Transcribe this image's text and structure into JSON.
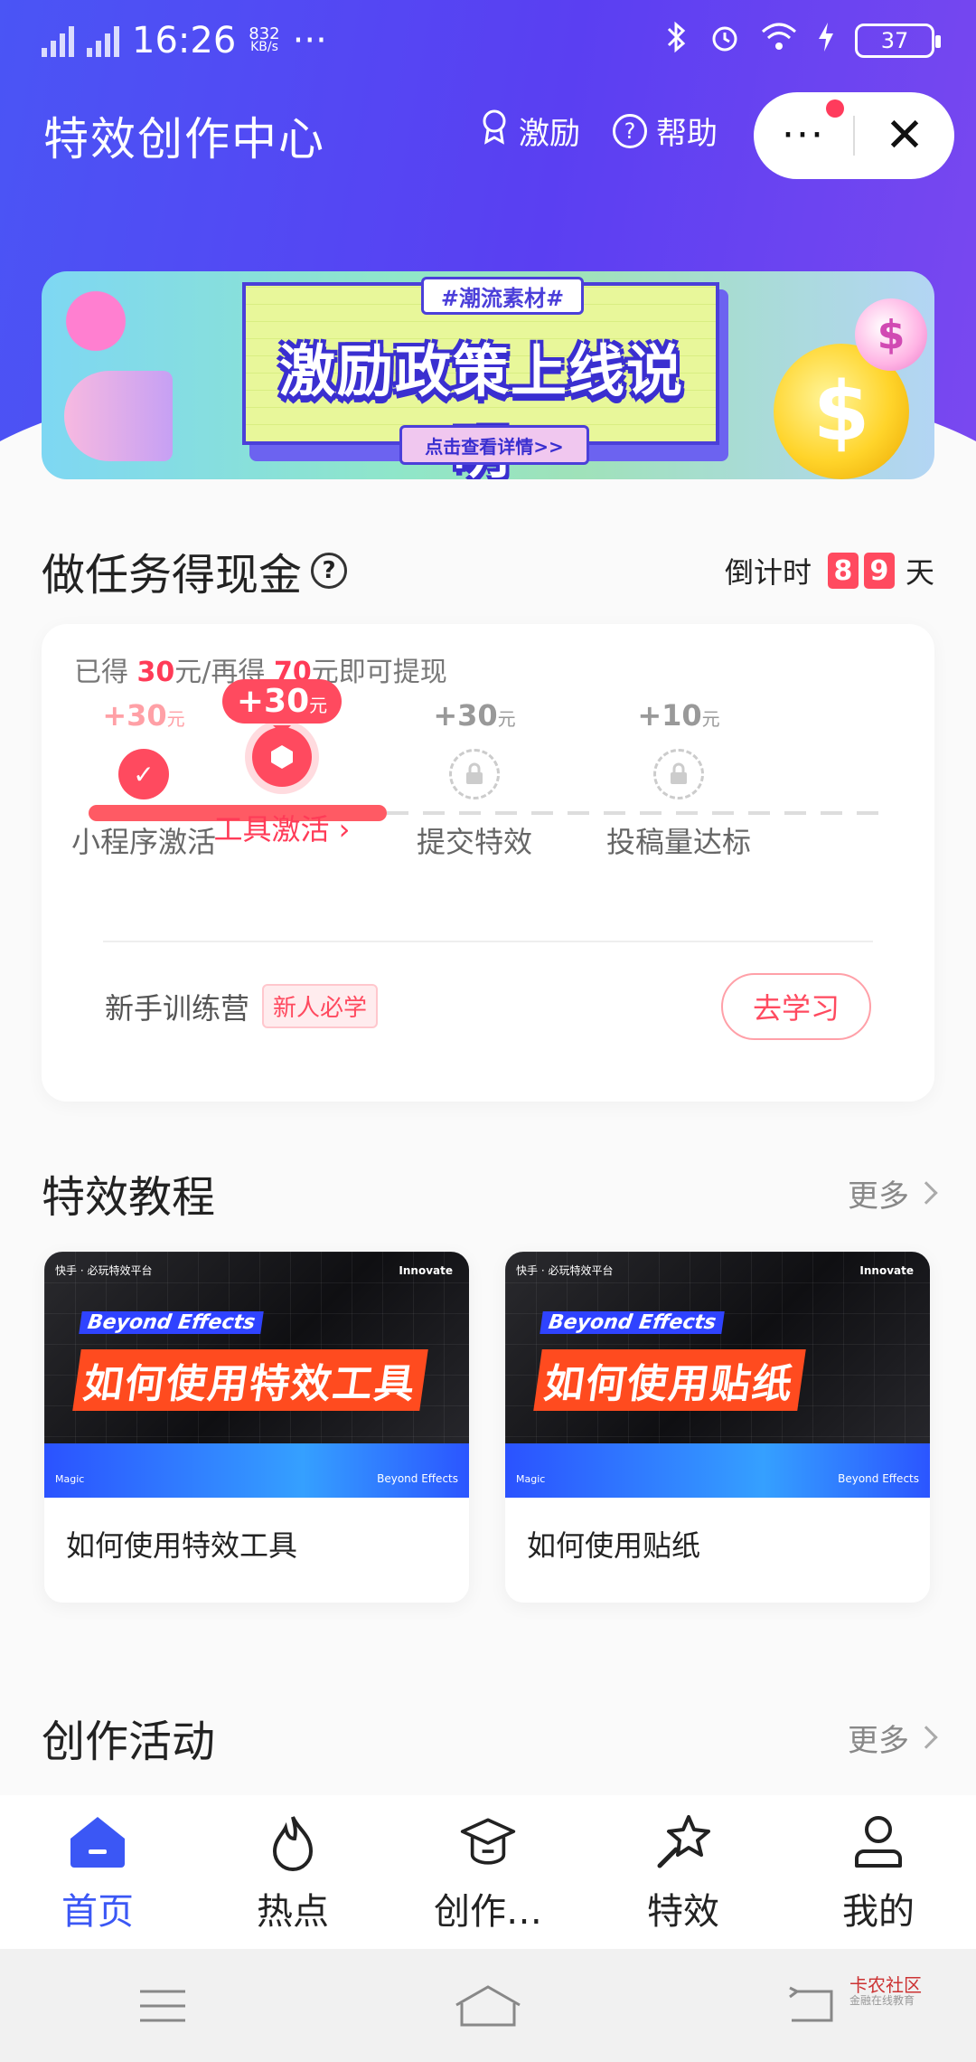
{
  "status_bar": {
    "time": "16:26",
    "net_speed": "832",
    "net_unit": "KB/s",
    "more": "···",
    "battery": "37"
  },
  "header": {
    "title": "特效创作中心",
    "reward_label": "激励",
    "help_label": "帮助",
    "menu": "···",
    "close": "✕"
  },
  "banner": {
    "tag": "#潮流素材#",
    "title": "激励政策上线说明",
    "button": "点击查看详情>>"
  },
  "tasks": {
    "title": "做任务得现金",
    "countdown_prefix": "倒计时",
    "countdown_digits": [
      "8",
      "9"
    ],
    "countdown_unit": "天",
    "earned_prefix": "已得 ",
    "earned_amount": "30",
    "earned_mid": "元/再得 ",
    "remaining_amount": "70",
    "earned_suffix": "元即可提现",
    "steps": [
      {
        "amount": "+30",
        "unit": "元",
        "label": "小程序激活",
        "state": "done"
      },
      {
        "amount": "+30",
        "unit": "元",
        "label": "工具激活 ›",
        "state": "current"
      },
      {
        "amount": "+30",
        "unit": "元",
        "label": "提交特效",
        "state": "locked"
      },
      {
        "amount": "+10",
        "unit": "元",
        "label": "投稿量达标",
        "state": "locked"
      }
    ],
    "camp_label": "新手训练营",
    "camp_tag": "新人必学",
    "camp_button": "去学习"
  },
  "tutorials": {
    "title": "特效教程",
    "more": "更多",
    "items": [
      {
        "thumb_badge": "快手 · 必玩特效平台",
        "thumb_brand": "Beyond Effects",
        "thumb_innovate": "Innovate",
        "thumb_magic": "Magic",
        "thumb_heading": "如何使用特效工具",
        "name": "如何使用特效工具"
      },
      {
        "thumb_badge": "快手 · 必玩特效平台",
        "thumb_brand": "Beyond Effects",
        "thumb_innovate": "Innovate",
        "thumb_magic": "Magic",
        "thumb_heading": "如何使用贴纸",
        "name": "如何使用贴纸"
      }
    ]
  },
  "activities": {
    "title": "创作活动",
    "more": "更多"
  },
  "tabbar": {
    "items": [
      {
        "label": "首页",
        "icon": "home-icon",
        "active": true
      },
      {
        "label": "热点",
        "icon": "flame-icon",
        "active": false
      },
      {
        "label": "创作…",
        "icon": "graduation-cap-icon",
        "active": false
      },
      {
        "label": "特效",
        "icon": "magic-wand-icon",
        "active": false
      },
      {
        "label": "我的",
        "icon": "user-icon",
        "active": false
      }
    ],
    "active_color": "#3b57f5"
  },
  "watermark": {
    "name": "卡农社区",
    "sub": "金融在线教育"
  },
  "colors": {
    "accent_red": "#ff4a5f",
    "header_blue": "#4a55f5"
  }
}
